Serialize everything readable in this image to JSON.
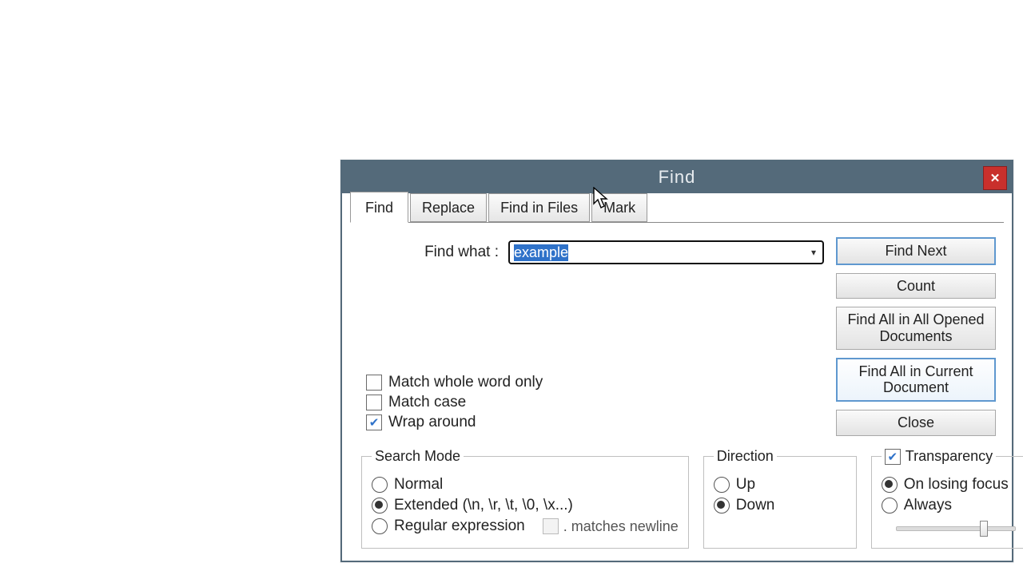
{
  "window": {
    "title": "Find",
    "close_glyph": "✕"
  },
  "tabs": [
    {
      "label": "Find",
      "active": true
    },
    {
      "label": "Replace",
      "active": false
    },
    {
      "label": "Find in Files",
      "active": false
    },
    {
      "label": "Mark",
      "active": false
    }
  ],
  "find": {
    "label": "Find what :",
    "value": "example",
    "dropdown_glyph": "▾"
  },
  "buttons": {
    "find_next": "Find Next",
    "count": "Count",
    "find_all_open": "Find All in All Opened Documents",
    "find_all_cur": "Find All in Current Document",
    "close": "Close"
  },
  "options": {
    "whole_word": {
      "label": "Match whole word only",
      "checked": false
    },
    "match_case": {
      "label": "Match case",
      "checked": false
    },
    "wrap": {
      "label": "Wrap around",
      "checked": true
    }
  },
  "search_mode": {
    "legend": "Search Mode",
    "normal": {
      "label": "Normal",
      "selected": false
    },
    "extended": {
      "label": "Extended (\\n, \\r, \\t, \\0, \\x...)",
      "selected": true
    },
    "regex": {
      "label": "Regular expression",
      "selected": false
    },
    "dot_nl_label": ". matches newline",
    "dot_nl_checked": false
  },
  "direction": {
    "legend": "Direction",
    "up": {
      "label": "Up",
      "selected": false
    },
    "down": {
      "label": "Down",
      "selected": true
    }
  },
  "transparency": {
    "enabled": true,
    "legend": "Transparency",
    "on_losing_focus": {
      "label": "On losing focus",
      "selected": true
    },
    "always": {
      "label": "Always",
      "selected": false
    },
    "slider_pct": 70
  }
}
